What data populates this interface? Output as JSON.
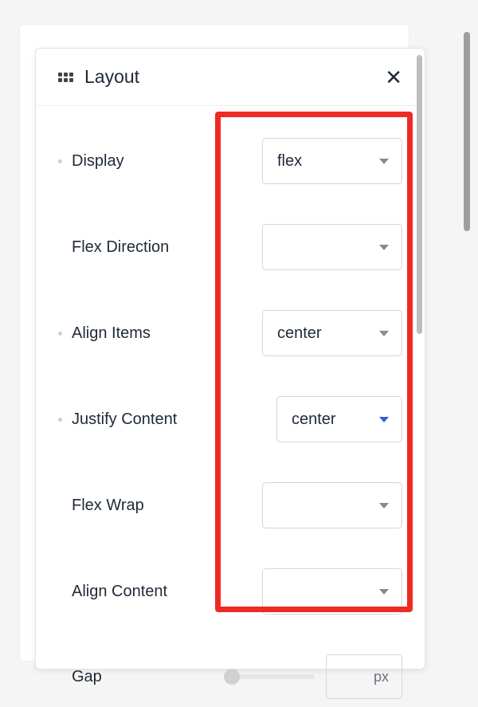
{
  "panel": {
    "title": "Layout"
  },
  "properties": {
    "display": {
      "label": "Display",
      "value": "flex"
    },
    "flex_direction": {
      "label": "Flex Direction",
      "value": ""
    },
    "align_items": {
      "label": "Align Items",
      "value": "center"
    },
    "justify_content": {
      "label": "Justify Content",
      "value": "center"
    },
    "flex_wrap": {
      "label": "Flex Wrap",
      "value": ""
    },
    "align_content": {
      "label": "Align Content",
      "value": ""
    },
    "gap": {
      "label": "Gap",
      "unit": "px"
    }
  }
}
